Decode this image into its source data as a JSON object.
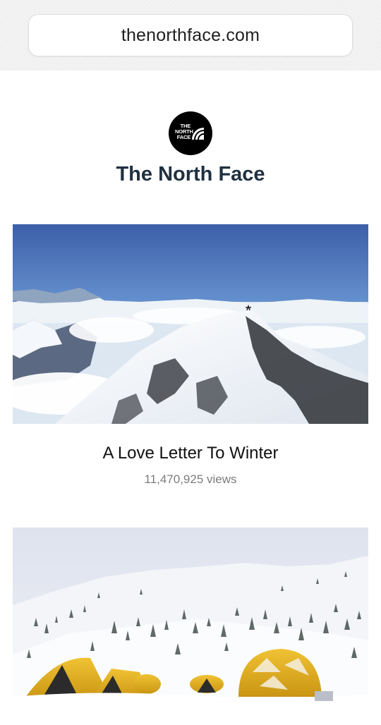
{
  "browser": {
    "url": "thenorthface.com"
  },
  "channel": {
    "logo_text_line1": "THE",
    "logo_text_line2": "NORTH",
    "logo_text_line3": "FACE",
    "name": "The North Face"
  },
  "videos": [
    {
      "title": "A Love Letter To Winter",
      "views": "11,470,925 views",
      "thumbnail": "snowy-mountain-peak-above-clouds"
    },
    {
      "title": "",
      "views": "",
      "thumbnail": "yellow-tents-on-snowy-slope"
    }
  ],
  "colors": {
    "title": "#203040",
    "views": "#7d7d7d",
    "tent_yellow": "#e6b41e"
  }
}
